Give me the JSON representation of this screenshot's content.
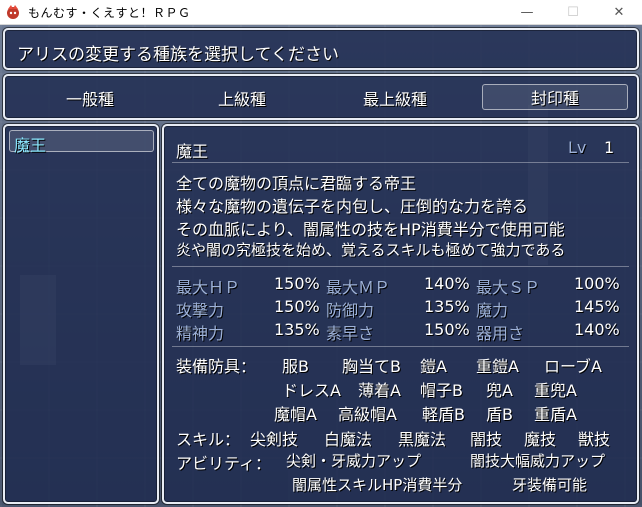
{
  "window": {
    "title": "もんむす・くえすと！ＲＰＧ",
    "minimize": "—",
    "maximize": "☐",
    "close": "✕"
  },
  "header": {
    "text": "アリスの変更する種族を選択してください"
  },
  "tabs": [
    {
      "label": "一般種"
    },
    {
      "label": "上級種"
    },
    {
      "label": "最上級種"
    },
    {
      "label": "封印種",
      "selected": true
    }
  ],
  "race_list": [
    {
      "label": "魔王",
      "selected": true
    }
  ],
  "detail": {
    "name": "魔王",
    "level_label": "Lv",
    "level_value": "1",
    "description": [
      "全ての魔物の頂点に君臨する帝王",
      "様々な魔物の遺伝子を内包し、圧倒的な力を誇る",
      "その血脈により、闇属性の技をHP消費半分で使用可能",
      "炎や闇の究極技を始め、覚えるスキルも極めて強力である"
    ],
    "stats": [
      [
        {
          "label": "最大ＨＰ",
          "value": "150%"
        },
        {
          "label": "最大ＭＰ",
          "value": "140%"
        },
        {
          "label": "最大ＳＰ",
          "value": "100%"
        }
      ],
      [
        {
          "label": "攻撃力",
          "value": "150%"
        },
        {
          "label": "防御力",
          "value": "135%"
        },
        {
          "label": "魔力",
          "value": "145%"
        }
      ],
      [
        {
          "label": "精神力",
          "value": "135%"
        },
        {
          "label": "素早さ",
          "value": "150%"
        },
        {
          "label": "器用さ",
          "value": "140%"
        }
      ]
    ],
    "equipment_label": "装備防具：",
    "equipment_rows": [
      [
        "服B",
        "胸当てB",
        "鎧A",
        "重鎧A",
        "ローブA"
      ],
      [
        "ドレスA",
        "薄着A",
        "帽子B",
        "兜A",
        "重兜A"
      ],
      [
        "魔帽A",
        "高級帽A",
        "軽盾B",
        "盾B",
        "重盾A"
      ]
    ],
    "skills_label": "スキル：",
    "skills": [
      "尖剣技",
      "白魔法",
      "黒魔法",
      "闇技",
      "魔技",
      "獣技"
    ],
    "abilities_label": "アビリティ：",
    "ability_rows": [
      [
        "尖剣・牙威力アップ",
        "闇技大幅威力アップ"
      ],
      [
        "闇属性スキルHP消費半分",
        "牙装備可能"
      ]
    ]
  },
  "colors": {
    "window_bg": "#1c284e",
    "system_text": "#9eb2d8",
    "selected_text": "#8be8ff"
  }
}
